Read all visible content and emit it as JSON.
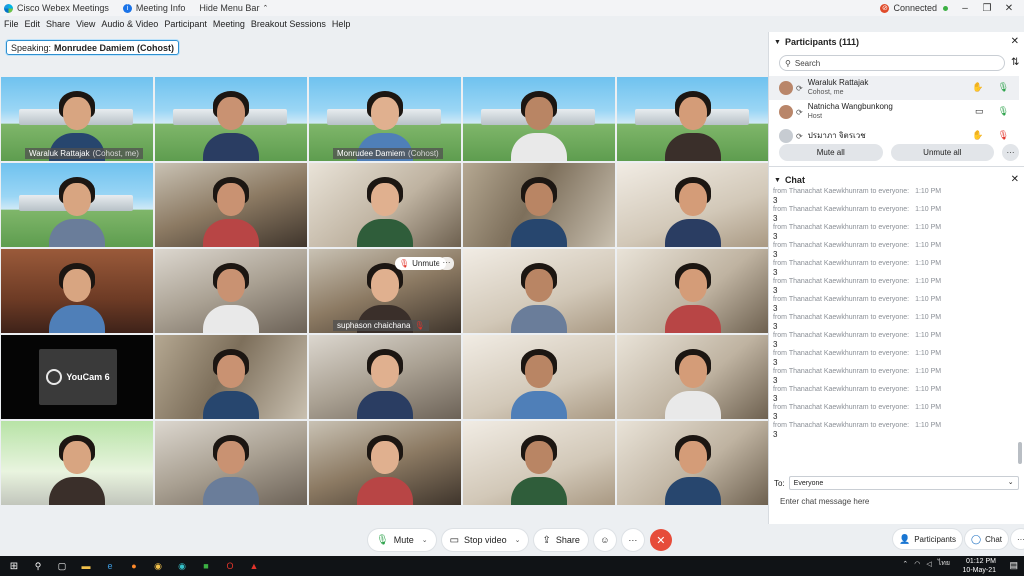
{
  "titlebar": {
    "app_name": "Cisco Webex Meetings",
    "meeting_info": "Meeting Info",
    "hide_menu": "Hide Menu Bar",
    "connection": "Connected",
    "minimize": "–",
    "restore": "❐",
    "close": "✕"
  },
  "menu": [
    "File",
    "Edit",
    "Share",
    "View",
    "Audio & Video",
    "Participant",
    "Meeting",
    "Breakout Sessions",
    "Help"
  ],
  "speaking": {
    "label": "Speaking:",
    "name": "Monrudee Damiem (Cohost)"
  },
  "tiles": [
    {
      "name": "Waraluk Rattajak",
      "sub": "(Cohost, me)",
      "scene": "school",
      "active": true
    },
    {
      "name": "",
      "sub": "",
      "scene": "school",
      "active": false
    },
    {
      "name": "Monrudee Damiem",
      "sub": "(Cohost)",
      "scene": "school",
      "active": true
    },
    {
      "name": "",
      "sub": "",
      "scene": "school",
      "active": false
    },
    {
      "name": "",
      "sub": "",
      "scene": "school",
      "active": false
    },
    {
      "name": "",
      "sub": "",
      "scene": "school",
      "active": false
    },
    {
      "name": "",
      "sub": "",
      "scene": "home1",
      "active": false
    },
    {
      "name": "",
      "sub": "",
      "scene": "home2",
      "active": false
    },
    {
      "name": "",
      "sub": "",
      "scene": "home3",
      "active": false
    },
    {
      "name": "",
      "sub": "",
      "scene": "home4",
      "active": false
    },
    {
      "name": "",
      "sub": "",
      "scene": "home5",
      "active": false
    },
    {
      "name": "",
      "sub": "",
      "scene": "home6",
      "active": false
    },
    {
      "name": "suphason chaichana",
      "sub": "",
      "scene": "home1",
      "active": false,
      "hover": true
    },
    {
      "name": "",
      "sub": "",
      "scene": "home4",
      "active": false
    },
    {
      "name": "",
      "sub": "",
      "scene": "home2",
      "active": false
    },
    {
      "name": "",
      "sub": "",
      "scene": "dark",
      "active": false,
      "youcam": true
    },
    {
      "name": "",
      "sub": "",
      "scene": "home3",
      "active": false
    },
    {
      "name": "",
      "sub": "",
      "scene": "home6",
      "active": false
    },
    {
      "name": "",
      "sub": "",
      "scene": "home4",
      "active": false
    },
    {
      "name": "",
      "sub": "",
      "scene": "home2",
      "active": false
    },
    {
      "name": "",
      "sub": "",
      "scene": "green",
      "active": false
    },
    {
      "name": "",
      "sub": "",
      "scene": "home6",
      "active": false
    },
    {
      "name": "",
      "sub": "",
      "scene": "home1",
      "active": false
    },
    {
      "name": "",
      "sub": "",
      "scene": "home4",
      "active": false
    },
    {
      "name": "",
      "sub": "",
      "scene": "home2",
      "active": false
    }
  ],
  "tile_overlay": {
    "unmute": "Unmute",
    "more": "···",
    "youcam_text": "YouCam 6"
  },
  "participants": {
    "title": "Participants (111)",
    "search_placeholder": "Search",
    "rows": [
      {
        "name": "Waraluk Rattajak",
        "role": "Cohost, me"
      },
      {
        "name": "Natnicha Wangbunkong",
        "role": "Host"
      },
      {
        "name": "ปรมาภา จิตรเวช",
        "role": ""
      }
    ],
    "mute_all": "Mute all",
    "unmute_all": "Unmute all",
    "more": "···"
  },
  "chat": {
    "title": "Chat",
    "messages": [
      {
        "from": "from Thanachat Kaewkhunram to everyone:",
        "time": "1:10 PM",
        "text": "3"
      },
      {
        "from": "from Thanachat Kaewkhunram to everyone:",
        "time": "1:10 PM",
        "text": "3"
      },
      {
        "from": "from Thanachat Kaewkhunram to everyone:",
        "time": "1:10 PM",
        "text": "3"
      },
      {
        "from": "from Thanachat Kaewkhunram to everyone:",
        "time": "1:10 PM",
        "text": "3"
      },
      {
        "from": "from Thanachat Kaewkhunram to everyone:",
        "time": "1:10 PM",
        "text": "3"
      },
      {
        "from": "from Thanachat Kaewkhunram to everyone:",
        "time": "1:10 PM",
        "text": "3"
      },
      {
        "from": "from Thanachat Kaewkhunram to everyone:",
        "time": "1:10 PM",
        "text": "3"
      },
      {
        "from": "from Thanachat Kaewkhunram to everyone:",
        "time": "1:10 PM",
        "text": "3"
      },
      {
        "from": "from Thanachat Kaewkhunram to everyone:",
        "time": "1:10 PM",
        "text": "3"
      },
      {
        "from": "from Thanachat Kaewkhunram to everyone:",
        "time": "1:10 PM",
        "text": "3"
      },
      {
        "from": "from Thanachat Kaewkhunram to everyone:",
        "time": "1:10 PM",
        "text": "3"
      },
      {
        "from": "from Thanachat Kaewkhunram to everyone:",
        "time": "1:10 PM",
        "text": "3"
      },
      {
        "from": "from Thanachat Kaewkhunram to everyone:",
        "time": "1:10 PM",
        "text": "3"
      },
      {
        "from": "from Thanachat Kaewkhunram to everyone:",
        "time": "1:10 PM",
        "text": "3"
      }
    ],
    "to_label": "To:",
    "to_value": "Everyone",
    "input_placeholder": "Enter chat message here"
  },
  "controls": {
    "mute": "Mute",
    "stop_video": "Stop video",
    "share": "Share",
    "emoji": "☺",
    "more": "···",
    "leave": "✕",
    "participants": "Participants",
    "chat": "Chat"
  },
  "taskbar": {
    "time": "01:12 PM",
    "date": "10-May-21",
    "lang": "ไทย"
  },
  "colors": {
    "accent": "#2fb7e5",
    "leave": "#e64c3a",
    "mic_on": "#2ca24a",
    "mic_off": "#e2342b"
  }
}
